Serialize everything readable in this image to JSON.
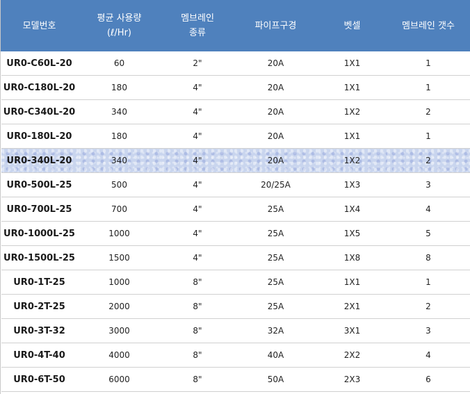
{
  "table": {
    "headers": [
      {
        "line1": "모델번호",
        "line2": ""
      },
      {
        "line1": "평균 사용량",
        "line2": "(ℓ/Hr)"
      },
      {
        "line1": "멤브레인",
        "line2": "종류"
      },
      {
        "line1": "파이프구경",
        "line2": ""
      },
      {
        "line1": "벳셀",
        "line2": ""
      },
      {
        "line1": "멤브레인 갯수",
        "line2": ""
      }
    ],
    "highlight_row": 4,
    "rows": [
      [
        "UR0-C60L-20",
        "60",
        "2\"",
        "20A",
        "1X1",
        "1"
      ],
      [
        "UR0-C180L-20",
        "180",
        "4\"",
        "20A",
        "1X1",
        "1"
      ],
      [
        "UR0-C340L-20",
        "340",
        "4\"",
        "20A",
        "1X2",
        "2"
      ],
      [
        "UR0-180L-20",
        "180",
        "4\"",
        "20A",
        "1X1",
        "1"
      ],
      [
        "UR0-340L-20",
        "340",
        "4\"",
        "20A",
        "1X2",
        "2"
      ],
      [
        "UR0-500L-25",
        "500",
        "4\"",
        "20/25A",
        "1X3",
        "3"
      ],
      [
        "UR0-700L-25",
        "700",
        "4\"",
        "25A",
        "1X4",
        "4"
      ],
      [
        "UR0-1000L-25",
        "1000",
        "4\"",
        "25A",
        "1X5",
        "5"
      ],
      [
        "UR0-1500L-25",
        "1500",
        "4\"",
        "25A",
        "1X8",
        "8"
      ],
      [
        "UR0-1T-25",
        "1000",
        "8\"",
        "25A",
        "1X1",
        "1"
      ],
      [
        "UR0-2T-25",
        "2000",
        "8\"",
        "25A",
        "2X1",
        "2"
      ],
      [
        "UR0-3T-32",
        "3000",
        "8\"",
        "32A",
        "3X1",
        "3"
      ],
      [
        "UR0-4T-40",
        "4000",
        "8\"",
        "40A",
        "2X2",
        "4"
      ],
      [
        "UR0-6T-50",
        "6000",
        "8\"",
        "50A",
        "2X3",
        "6"
      ]
    ]
  }
}
